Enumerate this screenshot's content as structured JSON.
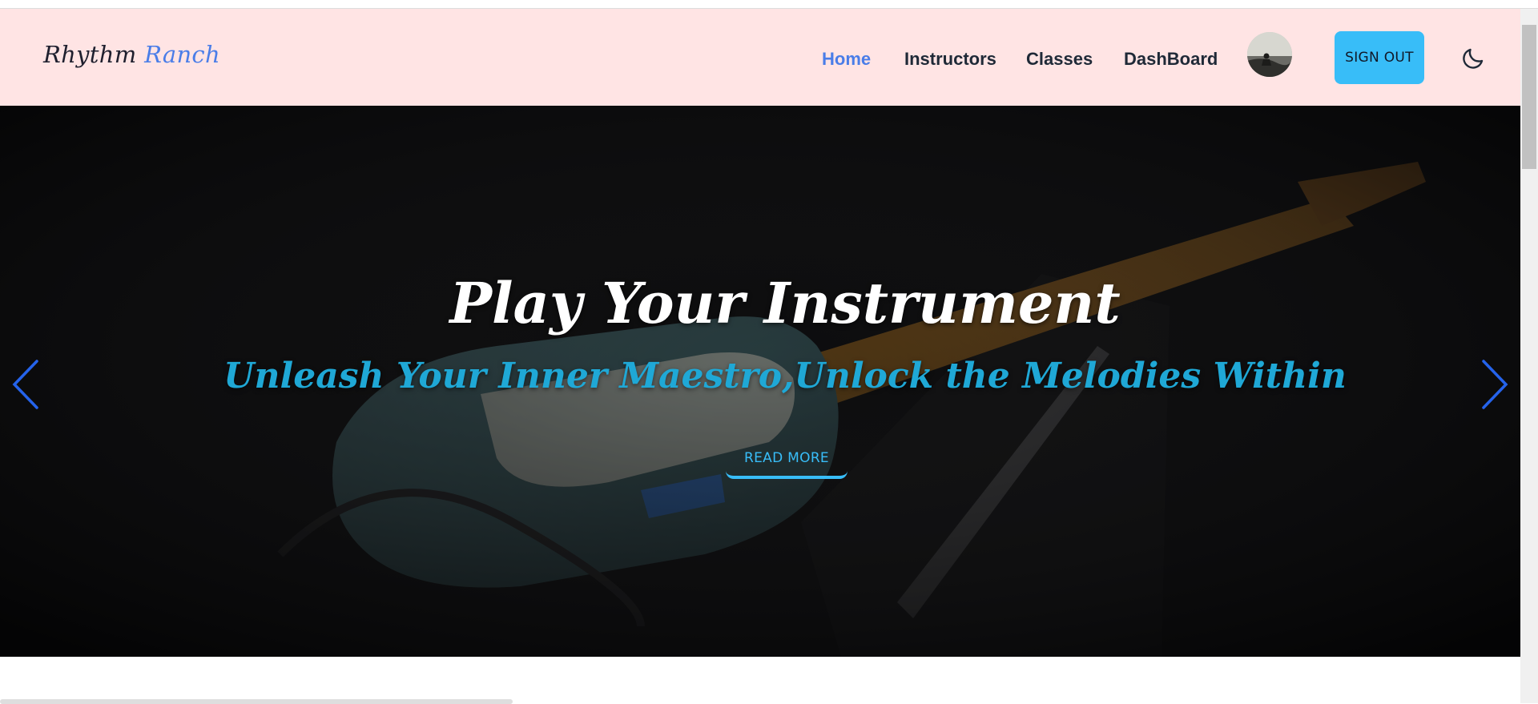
{
  "brand": {
    "name_part1": "Rhythm",
    "name_part2": "Ranch",
    "accent_color": "#4a7de8"
  },
  "nav": {
    "items": [
      {
        "label": "Home",
        "active": true
      },
      {
        "label": "Instructors",
        "active": false
      },
      {
        "label": "Classes",
        "active": false
      },
      {
        "label": "DashBoard",
        "active": false
      }
    ],
    "avatar_icon": "user-avatar",
    "sign_out_label": "SIGN OUT",
    "theme_toggle_icon": "moon-icon"
  },
  "hero": {
    "title": "Play Your Instrument",
    "subtitle": "Unleash Your Inner Maestro,Unlock the Melodies Within",
    "cta_label": "READ MORE",
    "prev_icon": "chevron-left-icon",
    "next_icon": "chevron-right-icon",
    "background": "guitar-on-amplifier-photo"
  },
  "colors": {
    "navbar_bg": "#ffe4e4",
    "button_bg": "#38bdf8",
    "subtitle": "#1fa8d6",
    "arrow": "#2563eb"
  }
}
